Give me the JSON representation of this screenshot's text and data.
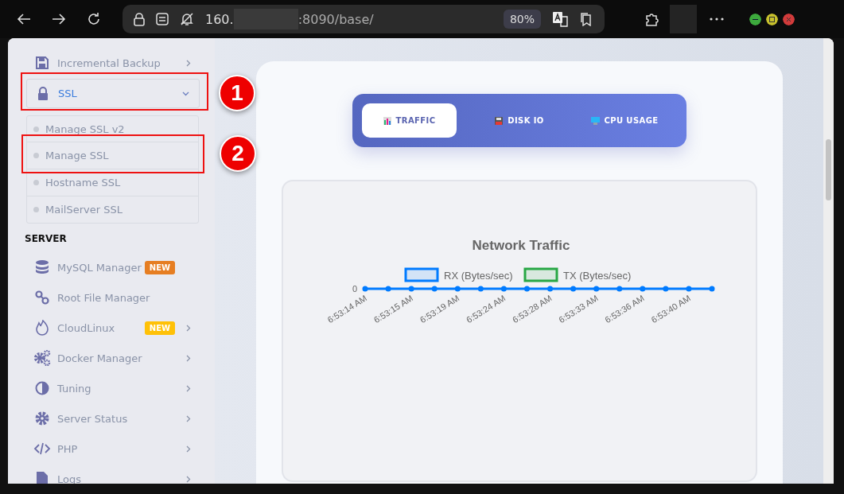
{
  "browser": {
    "url_start": "160.",
    "url_end": ":8090/base/",
    "zoom": "80%"
  },
  "sidebar": {
    "sections": [
      {
        "items": [
          {
            "label": "Incremental Backup",
            "kind": "submenu",
            "expanded": false,
            "selected": false
          },
          {
            "label": "SSL",
            "kind": "submenu",
            "expanded": true,
            "selected": true,
            "annotation": "1",
            "children": [
              {
                "label": "Manage SSL v2",
                "selected": false
              },
              {
                "label": "Manage SSL",
                "selected": false,
                "annotation": "2"
              },
              {
                "label": "Hostname SSL",
                "selected": false
              },
              {
                "label": "MailServer SSL",
                "selected": false
              }
            ]
          }
        ]
      },
      {
        "heading": "SERVER",
        "items": [
          {
            "label": "MySQL Manager",
            "kind": "link",
            "selected": false,
            "badge": {
              "text": "NEW",
              "color": "#e67e22"
            }
          },
          {
            "label": "Root File Manager",
            "kind": "link",
            "selected": false
          },
          {
            "label": "CloudLinux",
            "kind": "submenu",
            "expanded": false,
            "selected": false,
            "badge": {
              "text": "NEW",
              "color": "#ffc107"
            }
          },
          {
            "label": "Docker Manager",
            "kind": "submenu",
            "expanded": false,
            "selected": false
          },
          {
            "label": "Tuning",
            "kind": "submenu",
            "expanded": false,
            "selected": false
          },
          {
            "label": "Server Status",
            "kind": "submenu",
            "expanded": false,
            "selected": false
          },
          {
            "label": "PHP",
            "kind": "submenu",
            "expanded": false,
            "selected": false
          },
          {
            "label": "Logs",
            "kind": "submenu",
            "expanded": false,
            "selected": false
          }
        ]
      }
    ]
  },
  "tabs": [
    {
      "label": "TRAFFIC",
      "selected": true
    },
    {
      "label": "DISK IO",
      "selected": false
    },
    {
      "label": "CPU USAGE",
      "selected": false
    }
  ],
  "chart": {
    "title": "Network Traffic",
    "legend": [
      {
        "label": "RX (Bytes/sec)",
        "color": "#007bff"
      },
      {
        "label": "TX (Bytes/sec)",
        "color": "#28a745"
      }
    ],
    "y_axis_label": "0",
    "x_labels": [
      "6:53:14 AM",
      "6:53:15 AM",
      "6:53:19 AM",
      "6:53:24 AM",
      "6:53:28 AM",
      "6:53:33 AM",
      "6:53:36 AM",
      "6:53:40 AM"
    ]
  }
}
